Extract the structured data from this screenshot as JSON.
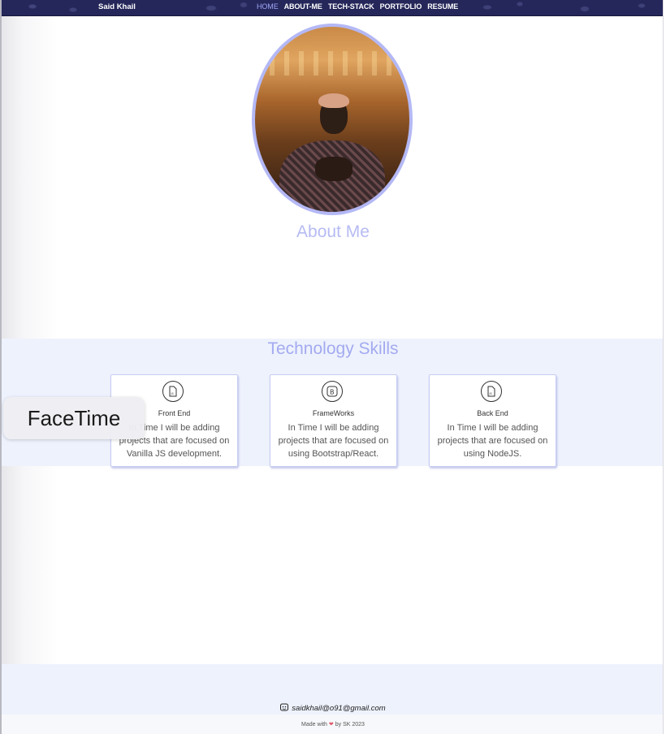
{
  "navbar": {
    "brand": "Said Khail",
    "links": [
      {
        "label": "HOME",
        "active": true
      },
      {
        "label": "ABOUT-ME",
        "active": false
      },
      {
        "label": "TECH-STACK",
        "active": false
      },
      {
        "label": "PORTFOLIO",
        "active": false
      },
      {
        "label": "RESUME",
        "active": false
      }
    ]
  },
  "about": {
    "title": "About Me"
  },
  "skills": {
    "title": "Technology Skills",
    "cards": [
      {
        "icon": "js-file-icon",
        "title": "Front End",
        "text": "In Time I will be adding projects that are focused on Vanilla JS development."
      },
      {
        "icon": "bootstrap-icon",
        "title": "FrameWorks",
        "text": "In Time I will be adding projects that are focused on using Bootstrap/React."
      },
      {
        "icon": "js-file-icon",
        "title": "Back End",
        "text": "In Time I will be adding projects that are focused on using NodeJS."
      }
    ]
  },
  "overlay": {
    "facetime": "FaceTime"
  },
  "footer": {
    "email": "saidkhail@o91@gmail.com",
    "made_with": "Made with",
    "by": "by SK 2023"
  },
  "colors": {
    "nav_bg": "#25275a",
    "accent": "#b6bbf3",
    "section_bg": "#eef2fd"
  }
}
